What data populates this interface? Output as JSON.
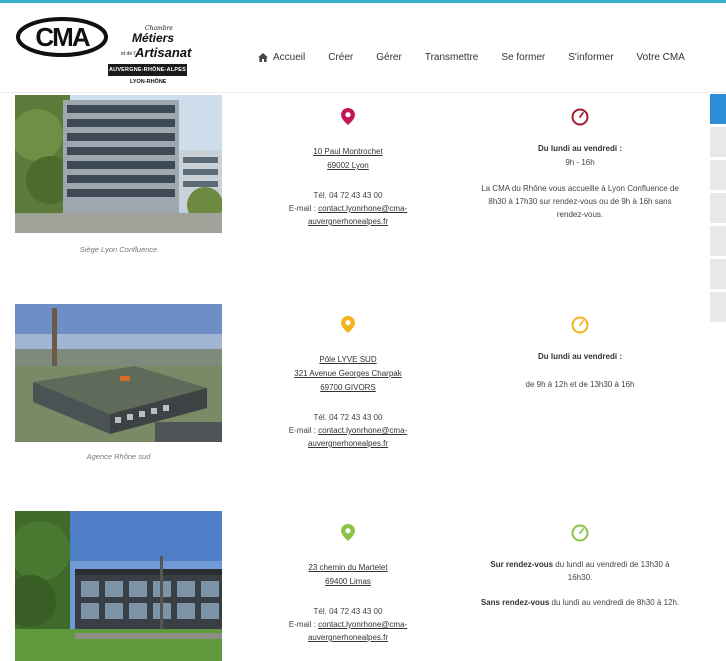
{
  "colors": {
    "topline": "#3bb0c9",
    "pin1": "#c2185b",
    "clock1": "#a11b33",
    "pin2": "#f2b31b",
    "clock2": "#f2b31b",
    "pin3": "#8bc34a",
    "clock3": "#8bc34a",
    "side_active": "#2d8dd6"
  },
  "logo": {
    "mark": "CMA",
    "small": "Chambre",
    "metiers": "Métiers",
    "et": "et de l'",
    "artisanat": "Artisanat",
    "band": "AUVERGNE-RHÔNE-ALPES",
    "region": "LYON-RHÔNE"
  },
  "nav": {
    "items": [
      {
        "label": "Accueil",
        "icon": "home-icon"
      },
      {
        "label": "Créer"
      },
      {
        "label": "Gérer"
      },
      {
        "label": "Transmettre"
      },
      {
        "label": "Se former"
      },
      {
        "label": "S'informer"
      },
      {
        "label": "Votre CMA"
      }
    ]
  },
  "agencies": [
    {
      "caption": "Siège Lyon Confluence",
      "address": [
        "10 Paul Montrochet",
        "69002 Lyon"
      ],
      "tel": "Tél. 04 72 43 43 00",
      "email_prefix": "E-mail : ",
      "email_part1": "contact.lyonrhone@cma-",
      "email_part2": "auvergnerhonealpes.fr",
      "hours_title": "Du lundi au vendredi :",
      "hours_line": "9h - 16h",
      "hours_note": "La CMA du Rhône vous accueille à Lyon Confluence de 8h30 à 17h30 sur rendez-vous ou de 9h à 16h sans rendez-vous."
    },
    {
      "caption": "Agence Rhône sud",
      "address": [
        "Pôle LYVE SUD",
        "321 Avenue Georges Charpak",
        "69700 GIVORS"
      ],
      "tel": "Tél. 04 72 43 43 00",
      "email_prefix": "E-mail : ",
      "email_part1": "contact.lyonrhone@cma-",
      "email_part2": "auvergnerhonealpes.fr",
      "hours_title": "Du lundi au vendredi :",
      "hours_line": "de 9h à 12h et de 13h30 à 16h"
    },
    {
      "address": [
        "23 chemin du Martelet",
        "69400 Limas"
      ],
      "tel": "Tél. 04 72 43 43 00",
      "email_prefix": "E-mail : ",
      "email_part1": "contact.lyonrhone@cma-",
      "email_part2": "auvergnerhonealpes.fr",
      "hours_bold1": "Sur rendez-vous",
      "hours_text1": " du lundi au vendredi de 13h30 à 16h30.",
      "hours_bold2": "Sans rendez-vous",
      "hours_text2": " du lundi au vendredi de 8h30 à 12h."
    }
  ]
}
